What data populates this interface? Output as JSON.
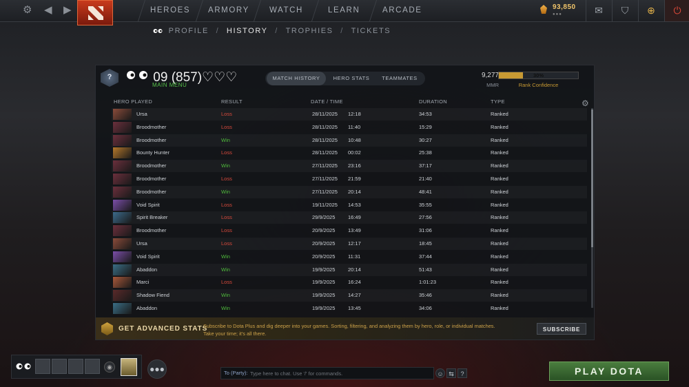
{
  "topbar": {
    "nav": [
      "HEROES",
      "ARMORY",
      "WATCH",
      "LEARN",
      "ARCADE"
    ],
    "shards": "93,850",
    "shard_dots": "●●●"
  },
  "subnav": {
    "items": [
      "PROFILE",
      "HISTORY",
      "TROPHIES",
      "TICKETS"
    ],
    "separator": "/"
  },
  "player": {
    "rank_badge": "?",
    "name": "09  (857)♡♡♡",
    "main_menu": "MAIN MENU",
    "mmr": "9,277",
    "mmr_label": "MMR",
    "confidence": 0.3,
    "confidence_text": "30%",
    "confidence_label": "Rank Confidence"
  },
  "tabs": [
    "MATCH HISTORY",
    "HERO STATS",
    "TEAMMATES"
  ],
  "table": {
    "headers": [
      "HERO PLAYED",
      "RESULT",
      "DATE / TIME",
      "DURATION",
      "TYPE"
    ],
    "rows": [
      {
        "hero": "Ursa",
        "result": "Loss",
        "date": "28/11/2025",
        "time": "12:18",
        "duration": "34:53",
        "type": "Ranked",
        "color": "#8a4b3a"
      },
      {
        "hero": "Broodmother",
        "result": "Loss",
        "date": "28/11/2025",
        "time": "11:40",
        "duration": "15:29",
        "type": "Ranked",
        "color": "#6b2f3c"
      },
      {
        "hero": "Broodmother",
        "result": "Win",
        "date": "28/11/2025",
        "time": "10:48",
        "duration": "30:27",
        "type": "Ranked",
        "color": "#6b2f3c"
      },
      {
        "hero": "Bounty Hunter",
        "result": "Loss",
        "date": "28/11/2025",
        "time": "00:02",
        "duration": "25:38",
        "type": "Ranked",
        "color": "#b5782b"
      },
      {
        "hero": "Broodmother",
        "result": "Win",
        "date": "27/11/2025",
        "time": "23:16",
        "duration": "37:17",
        "type": "Ranked",
        "color": "#6b2f3c"
      },
      {
        "hero": "Broodmother",
        "result": "Loss",
        "date": "27/11/2025",
        "time": "21:59",
        "duration": "21:40",
        "type": "Ranked",
        "color": "#6b2f3c"
      },
      {
        "hero": "Broodmother",
        "result": "Win",
        "date": "27/11/2025",
        "time": "20:14",
        "duration": "48:41",
        "type": "Ranked",
        "color": "#6b2f3c"
      },
      {
        "hero": "Void Spirit",
        "result": "Loss",
        "date": "19/11/2025",
        "time": "14:53",
        "duration": "35:55",
        "type": "Ranked",
        "color": "#7b4ea8"
      },
      {
        "hero": "Spirit Breaker",
        "result": "Loss",
        "date": "29/9/2025",
        "time": "16:49",
        "duration": "27:56",
        "type": "Ranked",
        "color": "#3b6a8a"
      },
      {
        "hero": "Broodmother",
        "result": "Loss",
        "date": "20/9/2025",
        "time": "13:49",
        "duration": "31:06",
        "type": "Ranked",
        "color": "#6b2f3c"
      },
      {
        "hero": "Ursa",
        "result": "Loss",
        "date": "20/9/2025",
        "time": "12:17",
        "duration": "18:45",
        "type": "Ranked",
        "color": "#8a4b3a"
      },
      {
        "hero": "Void Spirit",
        "result": "Win",
        "date": "20/9/2025",
        "time": "11:31",
        "duration": "37:44",
        "type": "Ranked",
        "color": "#7b4ea8"
      },
      {
        "hero": "Abaddon",
        "result": "Win",
        "date": "19/9/2025",
        "time": "20:14",
        "duration": "51:43",
        "type": "Ranked",
        "color": "#3a6e86"
      },
      {
        "hero": "Marci",
        "result": "Loss",
        "date": "19/9/2025",
        "time": "16:24",
        "duration": "1:01:23",
        "type": "Ranked",
        "color": "#a8583a"
      },
      {
        "hero": "Shadow Fiend",
        "result": "Win",
        "date": "19/9/2025",
        "time": "14:27",
        "duration": "35:46",
        "type": "Ranked",
        "color": "#5a2a2a"
      },
      {
        "hero": "Abaddon",
        "result": "Win",
        "date": "19/9/2025",
        "time": "13:45",
        "duration": "34:06",
        "type": "Ranked",
        "color": "#3a6e86"
      }
    ]
  },
  "advanced": {
    "title": "GET ADVANCED STATS",
    "description": "Subscribe to Dota Plus and dig deeper into your games. Sorting, filtering, and analyzing them by hero, role, or individual matches. Take your time; it's all there.",
    "button": "SUBSCRIBE"
  },
  "chat": {
    "to": "To (Party):",
    "placeholder": "Type here to chat. Use '/' for commands."
  },
  "play_button": "PLAY DOTA",
  "icons": {
    "settings": "gear-icon",
    "back": "arrow-left-icon",
    "forward": "arrow-right-icon",
    "mail": "mail-icon",
    "armory": "armory-icon",
    "plus": "dota-plus-icon",
    "power": "power-icon",
    "chat_wheel": "chat-wheel-icon"
  }
}
